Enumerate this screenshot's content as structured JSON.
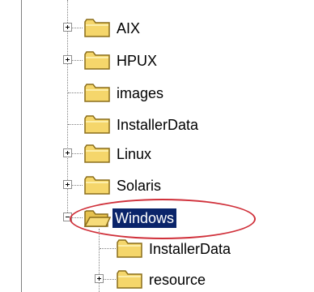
{
  "tree": {
    "items": [
      {
        "label": "AIX",
        "expandable": true,
        "state": "collapsed",
        "icon": "folder-icon"
      },
      {
        "label": "HPUX",
        "expandable": true,
        "state": "collapsed",
        "icon": "folder-icon"
      },
      {
        "label": "images",
        "expandable": false,
        "icon": "folder-icon"
      },
      {
        "label": "InstallerData",
        "expandable": false,
        "icon": "folder-icon"
      },
      {
        "label": "Linux",
        "expandable": true,
        "state": "collapsed",
        "icon": "folder-icon"
      },
      {
        "label": "Solaris",
        "expandable": true,
        "state": "collapsed",
        "icon": "folder-icon"
      },
      {
        "label": "Windows",
        "expandable": true,
        "state": "expanded",
        "selected": true,
        "icon": "open-folder-icon"
      },
      {
        "label": "InstallerData",
        "expandable": false,
        "icon": "folder-icon"
      },
      {
        "label": "resource",
        "expandable": true,
        "state": "collapsed",
        "icon": "folder-icon"
      }
    ]
  },
  "colors": {
    "selection_bg": "#0a246a",
    "selection_text": "#ffffff",
    "folder_fill": "#f5d66b",
    "folder_outline": "#8a6d1b",
    "annotation_ellipse": "#d0303a"
  }
}
